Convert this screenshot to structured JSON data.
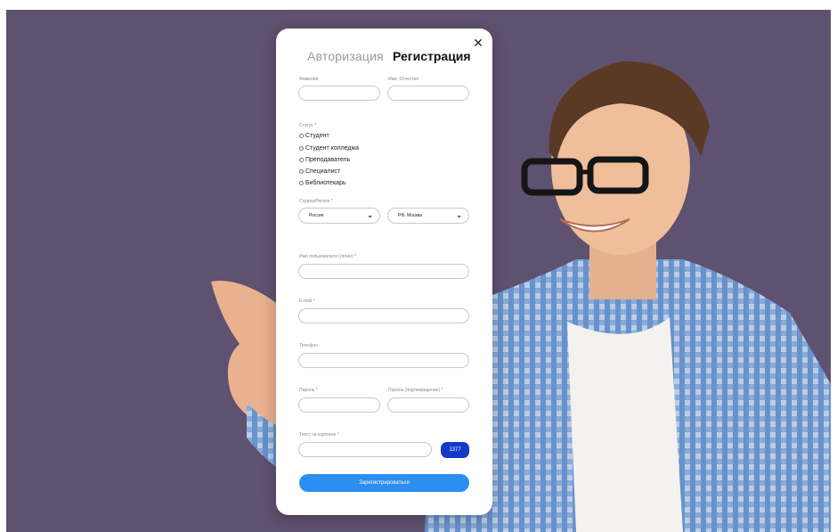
{
  "modal": {
    "close_icon": "close-icon",
    "tabs": {
      "login": "Авторизация",
      "register": "Регистрация"
    },
    "fields": {
      "last_name_label": "Фамилия",
      "first_middle_label": "Имя, Отчество",
      "status_label": "Статус *",
      "status_options": [
        "Студент",
        "Студент колледжа",
        "Преподаватель",
        "Специалист",
        "Библиотекарь"
      ],
      "region_label": "Страна/Регион *",
      "country_value": "Россия",
      "region_value": "РФ, Москва",
      "username_label": "Имя пользователя (логин) *",
      "email_label": "E-mail *",
      "phone_label": "Телефон",
      "password_label": "Пароль *",
      "password_confirm_label": "Пароль (подтверждение) *",
      "captcha_label": "Текст на картинке *",
      "captcha_text": "1377"
    },
    "submit_label": "Зарегистрироваться"
  },
  "colors": {
    "background": "#5f5170",
    "submit": "#2b8ef0",
    "captcha": "#1638c8"
  }
}
